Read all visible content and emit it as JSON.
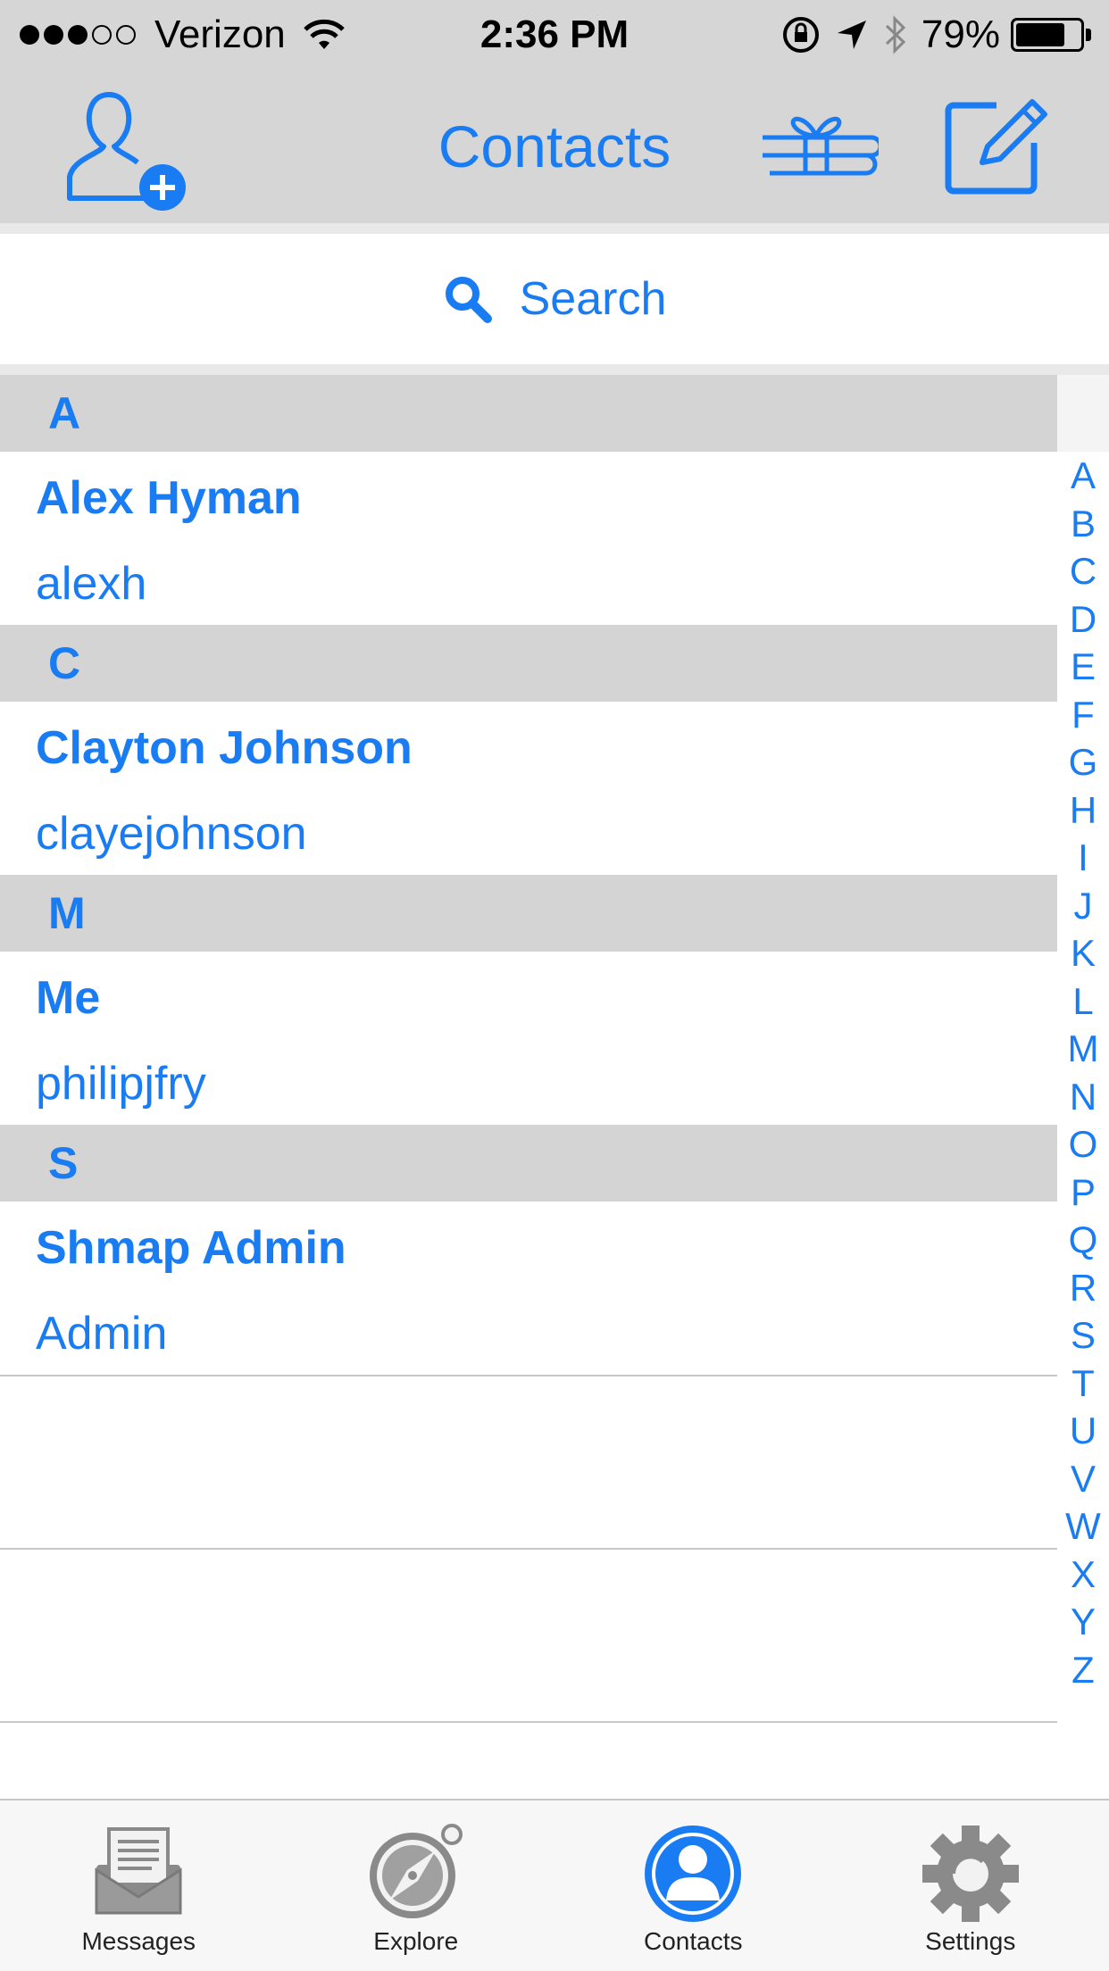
{
  "status_bar": {
    "carrier": "Verizon",
    "time": "2:36 PM",
    "battery_percent": "79%",
    "battery_level": 0.79,
    "signal_bars_filled": 3,
    "signal_bars_total": 5
  },
  "nav_bar": {
    "title": "Contacts",
    "left_icon": "add-contact-icon",
    "right_icons": [
      "gift-icon",
      "compose-icon"
    ]
  },
  "search": {
    "placeholder": "Search",
    "icon": "search-icon"
  },
  "sections": [
    {
      "letter": "A",
      "contacts": [
        {
          "name": "Alex Hyman",
          "handle": "alexh"
        }
      ]
    },
    {
      "letter": "C",
      "contacts": [
        {
          "name": "Clayton Johnson",
          "handle": "clayejohnson"
        }
      ]
    },
    {
      "letter": "M",
      "contacts": [
        {
          "name": "Me",
          "handle": "philipjfry"
        }
      ]
    },
    {
      "letter": "S",
      "contacts": [
        {
          "name": "Shmap Admin",
          "handle": "Admin"
        }
      ]
    }
  ],
  "index_letters": [
    "A",
    "B",
    "C",
    "D",
    "E",
    "F",
    "G",
    "H",
    "I",
    "J",
    "K",
    "L",
    "M",
    "N",
    "O",
    "P",
    "Q",
    "R",
    "S",
    "T",
    "U",
    "V",
    "W",
    "X",
    "Y",
    "Z"
  ],
  "tab_bar": {
    "tabs": [
      {
        "label": "Messages",
        "icon": "envelope-icon",
        "selected": false
      },
      {
        "label": "Explore",
        "icon": "compass-icon",
        "selected": false
      },
      {
        "label": "Contacts",
        "icon": "person-icon",
        "selected": true
      },
      {
        "label": "Settings",
        "icon": "gear-icon",
        "selected": false
      }
    ]
  },
  "colors": {
    "accent": "#1a7cf2",
    "bar_background": "#d6d6d6",
    "section_header": "#d4d4d4",
    "tab_inactive": "#8e8e8e"
  }
}
